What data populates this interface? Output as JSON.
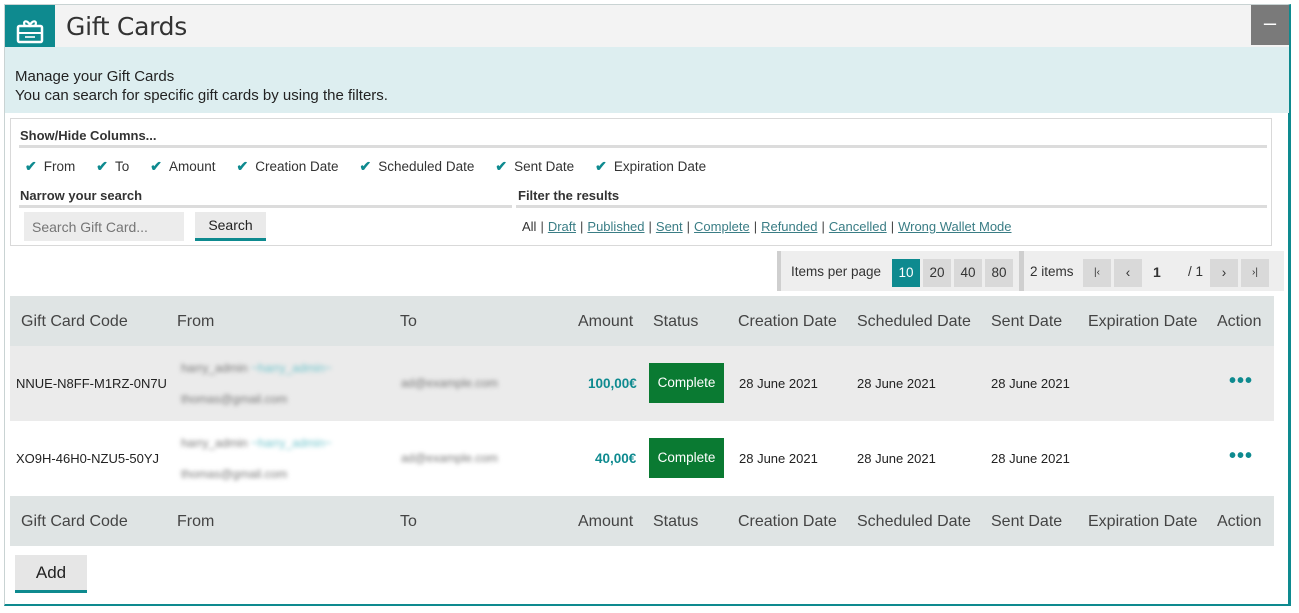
{
  "header": {
    "title": "Gift Cards",
    "collapse_label": "–",
    "icon": "gift-card-icon"
  },
  "intro": {
    "line1": "Manage your Gift Cards",
    "line2": "You can search for specific gift cards by using the filters."
  },
  "columns_section": {
    "label": "Show/Hide Columns...",
    "items": [
      {
        "label": "From",
        "checked": true
      },
      {
        "label": "To",
        "checked": true
      },
      {
        "label": "Amount",
        "checked": true
      },
      {
        "label": "Creation Date",
        "checked": true
      },
      {
        "label": "Scheduled Date",
        "checked": true
      },
      {
        "label": "Sent Date",
        "checked": true
      },
      {
        "label": "Expiration Date",
        "checked": true
      }
    ]
  },
  "search": {
    "label": "Narrow your search",
    "placeholder": "Search Gift Card...",
    "button": "Search"
  },
  "filter": {
    "label": "Filter the results",
    "current": "All",
    "links": [
      "Draft",
      "Published",
      "Sent",
      "Complete",
      "Refunded",
      "Cancelled",
      "Wrong Wallet Mode"
    ]
  },
  "pager": {
    "items_per_page_label": "Items per page",
    "sizes": [
      "10",
      "20",
      "40",
      "80"
    ],
    "active_size": "10",
    "count": "2 items",
    "first": "|‹",
    "prev": "‹",
    "page": "1",
    "total": "/ 1",
    "next": "›",
    "last": "›|"
  },
  "table": {
    "headers": [
      "Gift Card Code",
      "From",
      "To",
      "Amount",
      "Status",
      "Creation Date",
      "Scheduled Date",
      "Sent Date",
      "Expiration Date",
      "Action"
    ],
    "rows": [
      {
        "code": "NNUE-N8FF-M1RZ-0N7U",
        "from_name": "harry_admin",
        "from_alias": "~harry_admin~",
        "from_email": "thomas@gmail.com",
        "to": "ad@example.com",
        "amount": "100,00€",
        "status": "Complete",
        "creation_date": "28 June 2021",
        "scheduled_date": "28 June 2021",
        "sent_date": "28 June 2021",
        "expiration_date": "",
        "action": "•••"
      },
      {
        "code": "XO9H-46H0-NZU5-50YJ",
        "from_name": "harry_admin",
        "from_alias": "~harry_admin~",
        "from_email": "thomas@gmail.com",
        "to": "ad@example.com",
        "amount": "40,00€",
        "status": "Complete",
        "creation_date": "28 June 2021",
        "scheduled_date": "28 June 2021",
        "sent_date": "28 June 2021",
        "expiration_date": "",
        "action": "•••"
      }
    ]
  },
  "add_button": "Add",
  "colors": {
    "accent": "#0e8a8f",
    "status_complete": "#0a7a32",
    "intro_bg": "#ddeef0"
  }
}
